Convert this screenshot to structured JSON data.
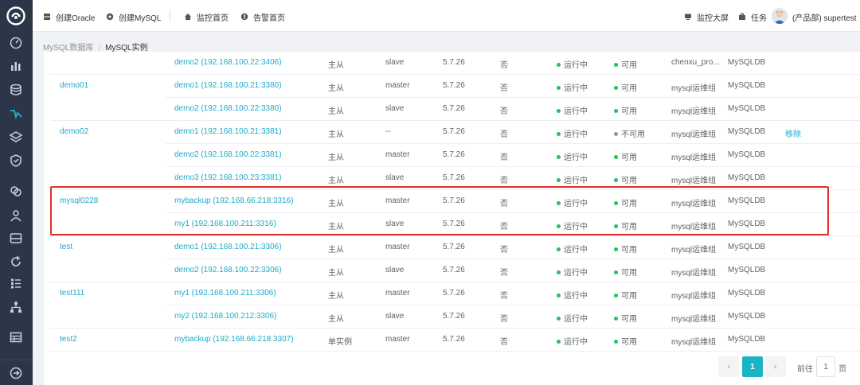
{
  "topbar": {
    "create_oracle": "创建Oracle",
    "create_mysql": "创建MySQL",
    "monitor_home": "监控首页",
    "alarm_home": "告警首页",
    "monitor_screen": "监控大屏",
    "tasks": "任务",
    "user": "(产品部) supertest"
  },
  "breadcrumb": {
    "parent": "MySQL数据库",
    "separator": "/",
    "current": "MySQL实例"
  },
  "colors": {
    "sidebar": "#2b3648",
    "link": "#1fa9c8",
    "status_green": "#23c15d",
    "highlight_border": "#e0302c",
    "page_active": "#19b5c6"
  },
  "sidebar_icons": [
    "gauge-icon",
    "bar-chart-icon",
    "database-icon",
    "pulse-icon",
    "layers-icon",
    "shield-icon",
    "cluster-icon",
    "users-icon",
    "storage-icon",
    "refresh-icon",
    "list-icon",
    "hierarchy-icon",
    "table-icon",
    "logout-icon"
  ],
  "rows": [
    {
      "group": "",
      "instance": "demo2 (192.168.100.22:3406)",
      "arch": "主从",
      "role": "slave",
      "version": "5.7.26",
      "flag": "否",
      "run": "运行中",
      "avail": "可用",
      "avail_ok": true,
      "team": "chenxu_pro...",
      "type": "MySQLDB",
      "action": ""
    },
    {
      "group": "demo01",
      "instance": "demo1 (192.168.100.21:3380)",
      "arch": "主从",
      "role": "master",
      "version": "5.7.26",
      "flag": "否",
      "run": "运行中",
      "avail": "可用",
      "avail_ok": true,
      "team": "mysql运维组",
      "type": "MySQLDB",
      "action": ""
    },
    {
      "group": "",
      "instance": "demo2 (192.168.100.22:3380)",
      "arch": "主从",
      "role": "slave",
      "version": "5.7.26",
      "flag": "否",
      "run": "运行中",
      "avail": "可用",
      "avail_ok": true,
      "team": "mysql运维组",
      "type": "MySQLDB",
      "action": ""
    },
    {
      "group": "demo02",
      "instance": "demo1 (192.168.100.21:3381)",
      "arch": "主从",
      "role": "--",
      "version": "5.7.26",
      "flag": "否",
      "run": "运行中",
      "avail": "不可用",
      "avail_ok": false,
      "team": "mysql运维组",
      "type": "MySQLDB",
      "action": "移除"
    },
    {
      "group": "",
      "instance": "demo2 (192.168.100.22:3381)",
      "arch": "主从",
      "role": "master",
      "version": "5.7.26",
      "flag": "否",
      "run": "运行中",
      "avail": "可用",
      "avail_ok": true,
      "team": "mysql运维组",
      "type": "MySQLDB",
      "action": ""
    },
    {
      "group": "",
      "instance": "demo3 (192.168.100.23:3381)",
      "arch": "主从",
      "role": "slave",
      "version": "5.7.26",
      "flag": "否",
      "run": "运行中",
      "avail": "可用",
      "avail_ok": true,
      "team": "mysql运维组",
      "type": "MySQLDB",
      "action": ""
    },
    {
      "group": "mysql0228",
      "instance": "mybackup (192.168.66.218:3316)",
      "arch": "主从",
      "role": "master",
      "version": "5.7.26",
      "flag": "否",
      "run": "运行中",
      "avail": "可用",
      "avail_ok": true,
      "team": "mysql运维组",
      "type": "MySQLDB",
      "action": ""
    },
    {
      "group": "",
      "instance": "my1 (192.168.100.211:3316)",
      "arch": "主从",
      "role": "slave",
      "version": "5.7.26",
      "flag": "否",
      "run": "运行中",
      "avail": "可用",
      "avail_ok": true,
      "team": "mysql运维组",
      "type": "MySQLDB",
      "action": ""
    },
    {
      "group": "test",
      "instance": "demo1 (192.168.100.21:3306)",
      "arch": "主从",
      "role": "master",
      "version": "5.7.26",
      "flag": "否",
      "run": "运行中",
      "avail": "可用",
      "avail_ok": true,
      "team": "mysql运维组",
      "type": "MySQLDB",
      "action": ""
    },
    {
      "group": "",
      "instance": "demo2 (192.168.100.22:3306)",
      "arch": "主从",
      "role": "slave",
      "version": "5.7.26",
      "flag": "否",
      "run": "运行中",
      "avail": "可用",
      "avail_ok": true,
      "team": "mysql运维组",
      "type": "MySQLDB",
      "action": ""
    },
    {
      "group": "test111",
      "instance": "my1 (192.168.100.211:3306)",
      "arch": "主从",
      "role": "master",
      "version": "5.7.26",
      "flag": "否",
      "run": "运行中",
      "avail": "可用",
      "avail_ok": true,
      "team": "mysql运维组",
      "type": "MySQLDB",
      "action": ""
    },
    {
      "group": "",
      "instance": "my2 (192.168.100.212:3306)",
      "arch": "主从",
      "role": "slave",
      "version": "5.7.26",
      "flag": "否",
      "run": "运行中",
      "avail": "可用",
      "avail_ok": true,
      "team": "mysql运维组",
      "type": "MySQLDB",
      "action": ""
    },
    {
      "group": "test2",
      "instance": "mybackup (192.168.66.218:3307)",
      "arch": "单实例",
      "role": "master",
      "version": "5.7.26",
      "flag": "否",
      "run": "运行中",
      "avail": "可用",
      "avail_ok": true,
      "team": "mysql运维组",
      "type": "MySQLDB",
      "action": ""
    }
  ],
  "pagination": {
    "current": "1",
    "goto_label": "前往",
    "goto_value": "1",
    "unit": "页"
  }
}
